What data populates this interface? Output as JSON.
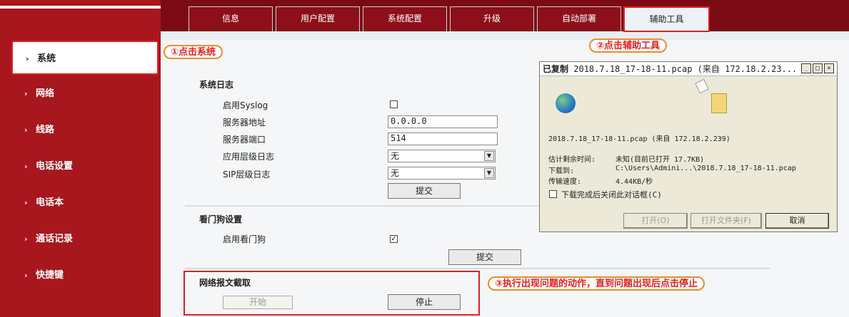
{
  "colors": {
    "brand_red": "#a8161e",
    "nav_dark": "#7a0b14",
    "annotation_red": "#e02020",
    "annotation_orange": "#ef8a2a"
  },
  "sidebar": {
    "items": [
      {
        "label": "系统",
        "icon": "chevron-right-icon",
        "active": true
      },
      {
        "label": "网络",
        "icon": "chevron-right-icon"
      },
      {
        "label": "线路",
        "icon": "chevron-right-icon"
      },
      {
        "label": "电话设置",
        "icon": "chevron-right-icon"
      },
      {
        "label": "电话本",
        "icon": "chevron-right-icon"
      },
      {
        "label": "通话记录",
        "icon": "chevron-right-icon"
      },
      {
        "label": "快捷键",
        "icon": "chevron-right-icon"
      }
    ],
    "arrow_glyph": "›"
  },
  "nav": {
    "tabs": [
      {
        "label": "信息"
      },
      {
        "label": "用户配置"
      },
      {
        "label": "系统配置"
      },
      {
        "label": "升级"
      },
      {
        "label": "自动部署"
      },
      {
        "label": "辅助工具",
        "active": true
      }
    ]
  },
  "syslog": {
    "title": "系统日志",
    "enable_label": "启用Syslog",
    "server_addr_label": "服务器地址",
    "server_addr_value": "0.0.0.0",
    "server_port_label": "服务器端口",
    "server_port_value": "514",
    "app_level_label": "应用层级日志",
    "app_level_value": "无",
    "sip_level_label": "SIP层级日志",
    "sip_level_value": "无",
    "submit_label": "提交"
  },
  "watchdog": {
    "title": "看门狗设置",
    "enable_label": "启用看门狗",
    "checked_glyph": "✓",
    "submit_label": "提交"
  },
  "capture": {
    "title": "网络报文截取",
    "start_label": "开始",
    "stop_label": "停止"
  },
  "annotations": {
    "step1": "①点击系统",
    "step2": "②点击辅助工具",
    "step3": "③执行出现问题的动作，直到问题出现后点击停止"
  },
  "dialog": {
    "title_prefix": "已复制",
    "title_rest": "2018.7.18_17-18-11.pcap (来自 172.18.2.23...",
    "file_line": "2018.7.18_17-18-11.pcap (来自 172.18.2.239)",
    "remaining_label": "估计剩余时间:",
    "remaining_value": "未知(目前已打开 17.7KB)",
    "download_to_label": "下载到:",
    "download_to_value": "C:\\Users\\Admini...\\2018.7.18_17-18-11.pcap",
    "speed_label": "传输速度:",
    "speed_value": "4.44KB/秒",
    "close_when_done": "下载完成后关闭此对话框(C)",
    "open_label": "打开(O)",
    "open_folder_label": "打开文件夹(F)",
    "cancel_label": "取消",
    "min_glyph": "_",
    "max_glyph": "□",
    "close_glyph": "×"
  }
}
